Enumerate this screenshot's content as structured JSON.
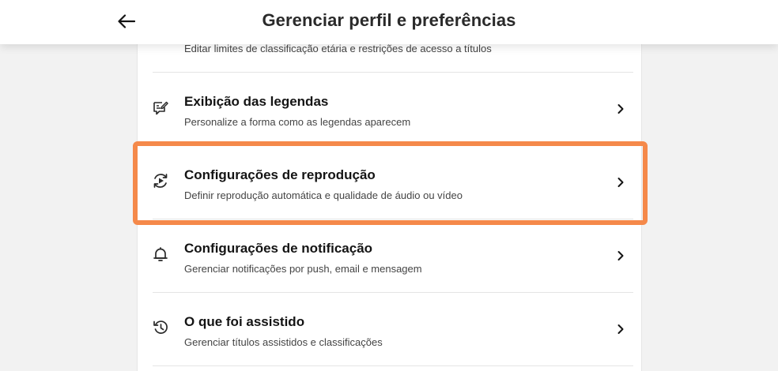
{
  "header": {
    "title": "Gerenciar perfil e preferências",
    "back_icon": "arrow-left-icon"
  },
  "settings": {
    "items": [
      {
        "title": "",
        "subtitle": "Editar limites de classificação etária e restrições de acesso a títulos",
        "icon": "none",
        "partially_visible": true
      },
      {
        "title": "Exibição das legendas",
        "subtitle": "Personalize a forma como as legendas aparecem",
        "icon": "subtitles-edit-icon"
      },
      {
        "title": "Configurações de reprodução",
        "subtitle": "Definir reprodução automática e qualidade de áudio ou vídeo",
        "icon": "playback-settings-icon",
        "highlighted": true
      },
      {
        "title": "Configurações de notificação",
        "subtitle": "Gerenciar notificações por push, email e mensagem",
        "icon": "bell-icon"
      },
      {
        "title": "O que foi assistido",
        "subtitle": "Gerenciar títulos assistidos e classificações",
        "icon": "history-icon"
      }
    ],
    "chevron_icon": "chevron-right-icon"
  },
  "colors": {
    "highlight": "#f5894a",
    "background": "#f2f2f2",
    "panel": "#ffffff",
    "text": "#141414"
  }
}
